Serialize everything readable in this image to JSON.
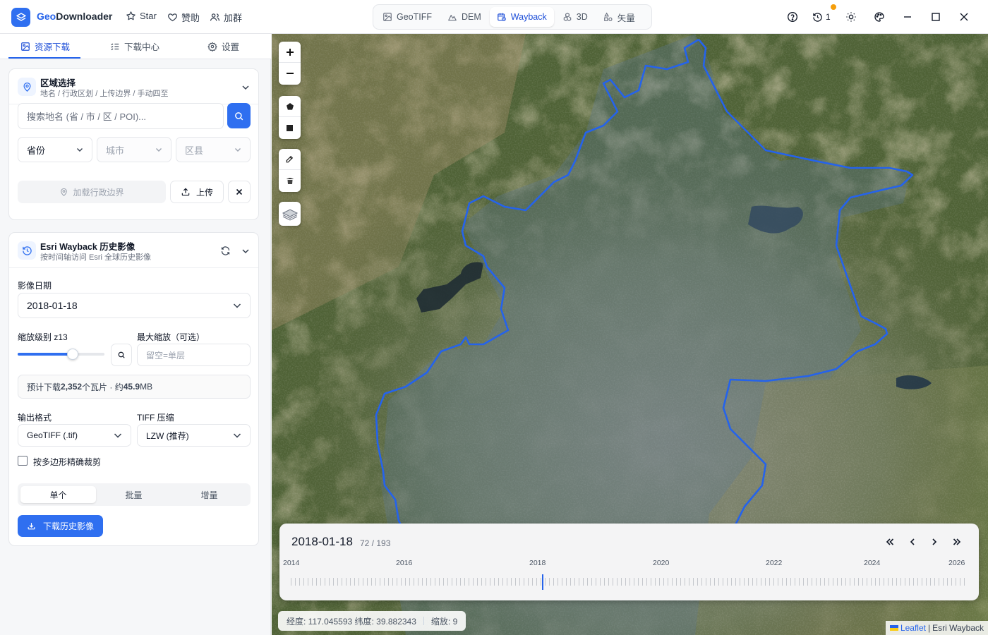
{
  "app": {
    "title_prefix": "Geo",
    "title_suffix": "Downloader",
    "links": {
      "star": "Star",
      "sponsor": "赞助",
      "group": "加群"
    },
    "history_count": "1"
  },
  "modes": [
    {
      "label": "GeoTIFF"
    },
    {
      "label": "DEM"
    },
    {
      "label": "Wayback"
    },
    {
      "label": "3D"
    },
    {
      "label": "矢量"
    }
  ],
  "tabs": {
    "download": "资源下载",
    "center": "下载中心",
    "settings": "设置"
  },
  "region": {
    "title": "区域选择",
    "subtitle": "地名 / 行政区划 / 上传边界 / 手动四至",
    "search_placeholder": "搜索地名 (省 / 市 / 区 / POI)...",
    "province": "省份",
    "city": "城市",
    "district": "区县",
    "load_boundary": "加载行政边界",
    "upload": "上传"
  },
  "wayback": {
    "title": "Esri Wayback 历史影像",
    "subtitle": "按时间轴访问 Esri 全球历史影像",
    "date_label": "影像日期",
    "date_value": "2018-01-18",
    "zoom_label": "缩放级别 z13",
    "zoom_value": 13,
    "zoom_min": 0,
    "zoom_max": 20,
    "max_zoom_label": "最大缩放（可选）",
    "max_zoom_placeholder": "留空=单层",
    "estimate_prefix": "预计下载 ",
    "estimate_tiles": "2,352",
    "estimate_mid": " 个瓦片 · 约 ",
    "estimate_size": "45.9",
    "estimate_unit": " MB",
    "format_label": "输出格式",
    "format_value": "GeoTIFF (.tif)",
    "compress_label": "TIFF 压缩",
    "compress_value": "LZW (推荐)",
    "clip_label": "按多边形精确裁剪",
    "seg": [
      "单个",
      "批量",
      "增量"
    ],
    "download_button": "下载历史影像"
  },
  "timeline": {
    "date": "2018-01-18",
    "index": "72 / 193",
    "current": 72,
    "total": 193,
    "years": [
      "2014",
      "2016",
      "2018",
      "2020",
      "2022",
      "2024",
      "2026"
    ]
  },
  "status": {
    "coords": "经度: 117.045593 纬度: 39.882343",
    "zoom": "缩放: 9"
  },
  "attribution": {
    "leaflet": "Leaflet",
    "sep": " | ",
    "source": "Esri Wayback"
  },
  "colors": {
    "accent": "#2f6ff0",
    "boundary": "#2563eb",
    "notification": "#f59e0b"
  }
}
